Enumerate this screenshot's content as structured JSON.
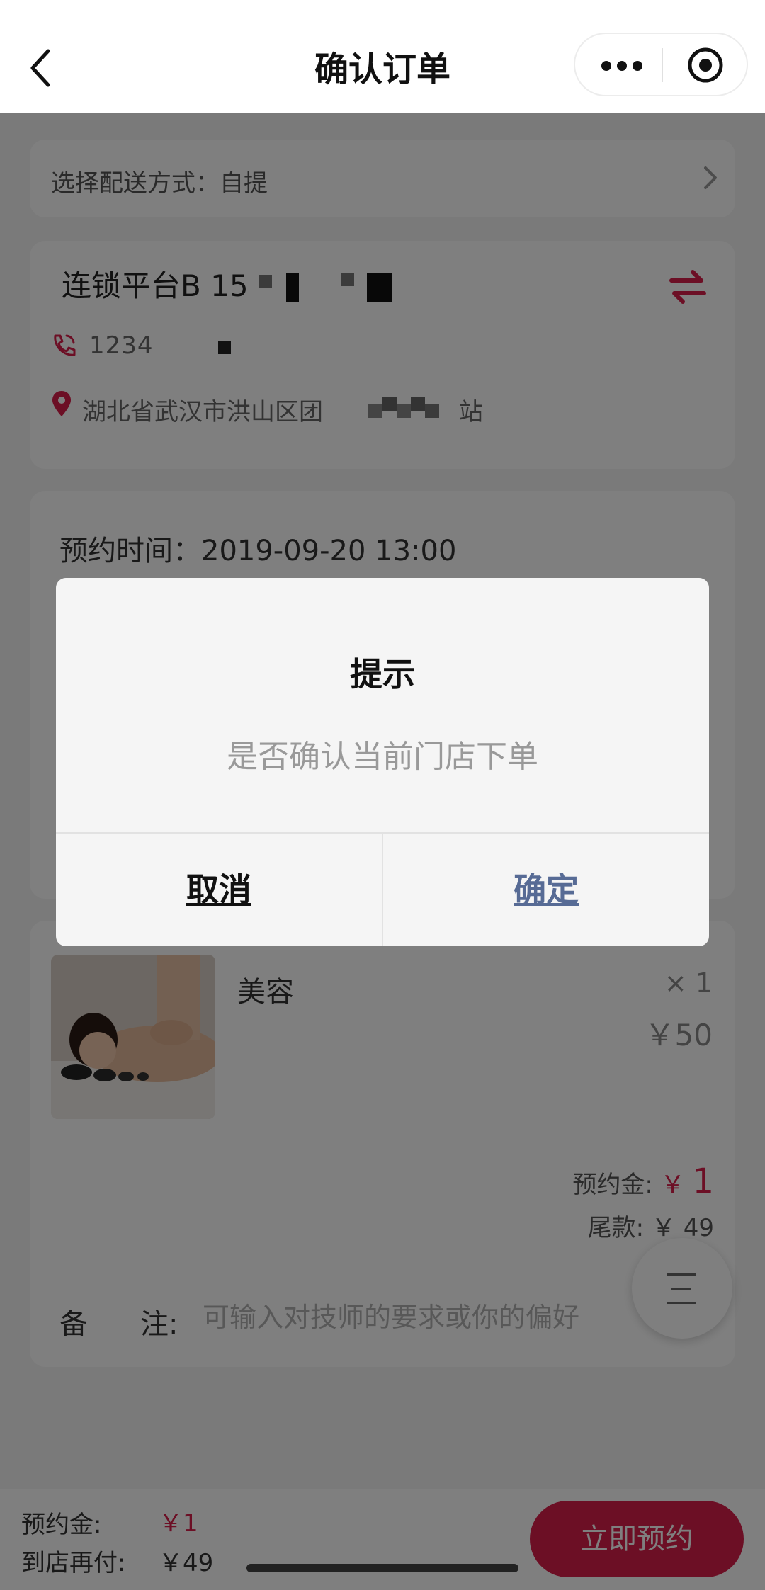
{
  "nav": {
    "title": "确认订单",
    "back_icon": "chevron-left-icon",
    "more_icon": "more-dots-icon",
    "close_icon": "target-circle-icon"
  },
  "delivery": {
    "label": "选择配送方式：自提",
    "arrow_icon": "chevron-right-icon"
  },
  "store": {
    "name": "连锁平台B 15",
    "phone": "1234",
    "address": "湖北省武汉市洪山区团",
    "address_tail": "站",
    "switch_icon": "swap-arrows-icon"
  },
  "booking": {
    "time": "预约时间：2019-09-20 13:00"
  },
  "goods": {
    "name": "美容",
    "qty": "× 1",
    "price": "￥50",
    "deposit_label": "预约金:",
    "deposit_currency": "￥",
    "deposit_value": "1",
    "balance": "尾款: ￥ 49",
    "remark_label_a": "备",
    "remark_label_b": "注:",
    "remark_placeholder": "可输入对技师的要求或你的偏好"
  },
  "bottom": {
    "deposit_label": "预约金:",
    "deposit_value": "￥1",
    "pay_label": "到店再付:",
    "pay_value": "￥49",
    "button": "立即预约"
  },
  "dialog": {
    "title": "提示",
    "message": "是否确认当前门店下单",
    "cancel": "取消",
    "confirm": "确定"
  },
  "colors": {
    "accent": "#d81e4a",
    "dialog_confirm": "#576b95"
  }
}
